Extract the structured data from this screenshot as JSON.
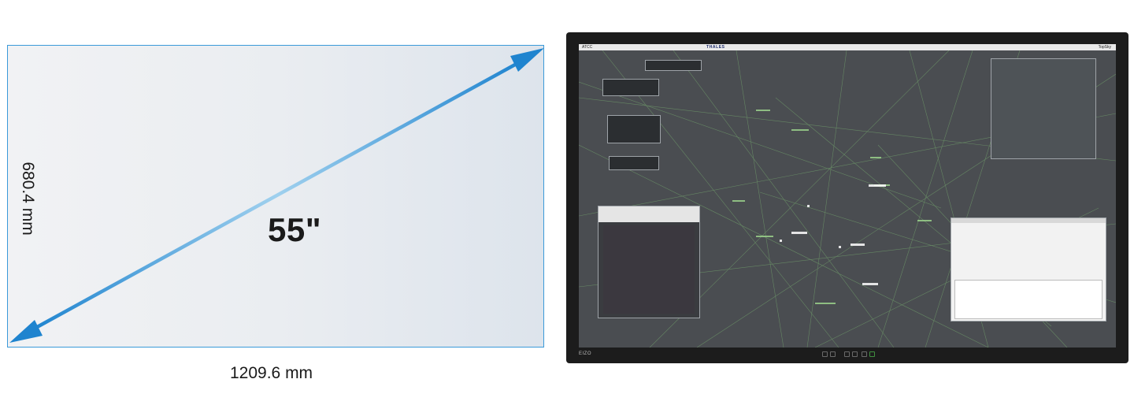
{
  "diagram": {
    "diagonal_label": "55\"",
    "width_label": "1209.6 mm",
    "height_label": "680.4 mm",
    "colors": {
      "frame": "#3a9ad9",
      "arrow_dark": "#1f84cf",
      "arrow_light": "#9fd0ee"
    }
  },
  "monitor": {
    "brand_logo": "EIZO",
    "screen": {
      "topbar": {
        "app_name": "ATCC",
        "logo": "THALES",
        "user": "TopSky"
      },
      "colors": {
        "background": "#4a4d51",
        "route_lines": "#6f9a6a",
        "labels": "#9fd98f"
      }
    }
  }
}
